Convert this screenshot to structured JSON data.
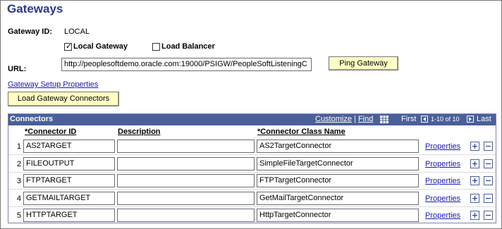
{
  "page": {
    "title": "Gateways"
  },
  "gateway": {
    "id_label": "Gateway ID:",
    "id_value": "LOCAL",
    "local_gateway_label": "Local Gateway",
    "local_gateway_checked": true,
    "load_balancer_label": "Load Balancer",
    "load_balancer_checked": false,
    "url_label": "URL:",
    "url_value": "http://peoplesoftdemo.oracle.com:19000/PSIGW/PeopleSoftListeningC",
    "ping_button": "Ping Gateway",
    "setup_link": "Gateway Setup Properties",
    "load_connectors_button": "Load Gateway Connectors"
  },
  "connectors": {
    "title": "Connectors",
    "customize": "Customize",
    "separator": "|",
    "find": "Find",
    "first": "First",
    "range": "1-10 of 10",
    "last": "Last",
    "columns": {
      "connector_id": "*Connector ID",
      "description": "Description",
      "class_name": "*Connector Class Name"
    },
    "properties_label": "Properties",
    "rows": [
      {
        "num": "1",
        "id": "AS2TARGET",
        "description": "",
        "class_name": "AS2TargetConnector"
      },
      {
        "num": "2",
        "id": "FILEOUTPUT",
        "description": "",
        "class_name": "SimpleFileTargetConnector"
      },
      {
        "num": "3",
        "id": "FTPTARGET",
        "description": "",
        "class_name": "FTPTargetConnector"
      },
      {
        "num": "4",
        "id": "GETMAILTARGET",
        "description": "",
        "class_name": "GetMailTargetConnector"
      },
      {
        "num": "5",
        "id": "HTTPTARGET",
        "description": "",
        "class_name": "HttpTargetConnector"
      }
    ]
  },
  "colors": {
    "title": "#2b3a8c",
    "grid_header": "#4b5f98",
    "button_bg": "#ffffc4",
    "link": "#1a1ab0"
  }
}
